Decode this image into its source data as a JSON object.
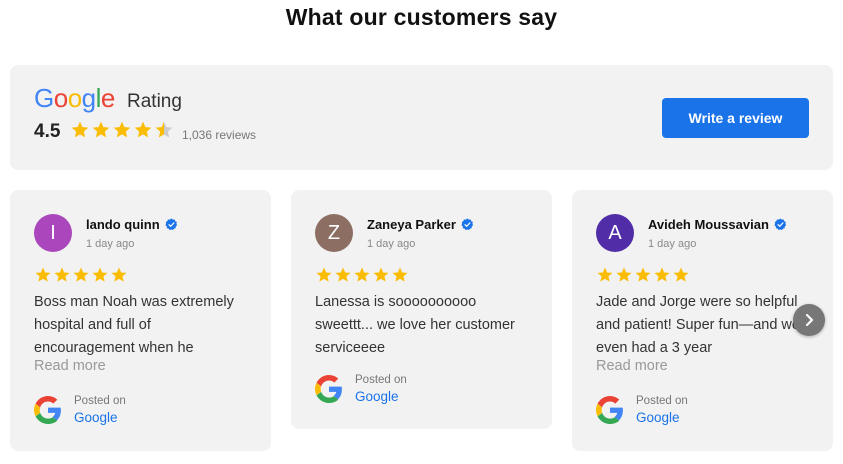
{
  "heading": "What our customers say",
  "summary": {
    "logo_letters": [
      {
        "ch": "G",
        "color": "#4285F4"
      },
      {
        "ch": "o",
        "color": "#EA4335"
      },
      {
        "ch": "o",
        "color": "#FBBC05"
      },
      {
        "ch": "g",
        "color": "#4285F4"
      },
      {
        "ch": "l",
        "color": "#34A853"
      },
      {
        "ch": "e",
        "color": "#EA4335"
      }
    ],
    "rating_word": "Rating",
    "score": "4.5",
    "stars_value": 4.5,
    "review_count": "1,036  reviews",
    "write_review_label": "Write a review"
  },
  "colors": {
    "star": "#FBBC04",
    "star_empty": "#cccccc",
    "accent": "#1a73e8",
    "verified": "#1a73e8"
  },
  "reviews": [
    {
      "initial": "I",
      "avatar_color": "#AB47BC",
      "name": "lando quinn",
      "date": "1 day ago",
      "rating": 5,
      "text": "Boss man Noah was extremely hospital and full of encouragement when he",
      "read_more": "Read more",
      "posted_label": "Posted on",
      "posted_source": "Google"
    },
    {
      "initial": "Z",
      "avatar_color": "#8D6E63",
      "name": "Zaneya Parker",
      "date": "1 day ago",
      "rating": 5,
      "text": "Lanessa is soooooooooo sweettt... we love her customer serviceeee",
      "read_more": "",
      "posted_label": "Posted on",
      "posted_source": "Google"
    },
    {
      "initial": "A",
      "avatar_color": "#512DA8",
      "name": "Avideh Moussavian",
      "date": "1 day ago",
      "rating": 5,
      "text": "Jade and Jorge were so helpful and patient! Super fun—and we even had a 3 year",
      "read_more": "Read more",
      "posted_label": "Posted on",
      "posted_source": "Google"
    }
  ],
  "icons": {
    "star": "star-icon",
    "verified": "verified-check-icon",
    "google": "google-g-icon",
    "next": "chevron-right-icon"
  }
}
